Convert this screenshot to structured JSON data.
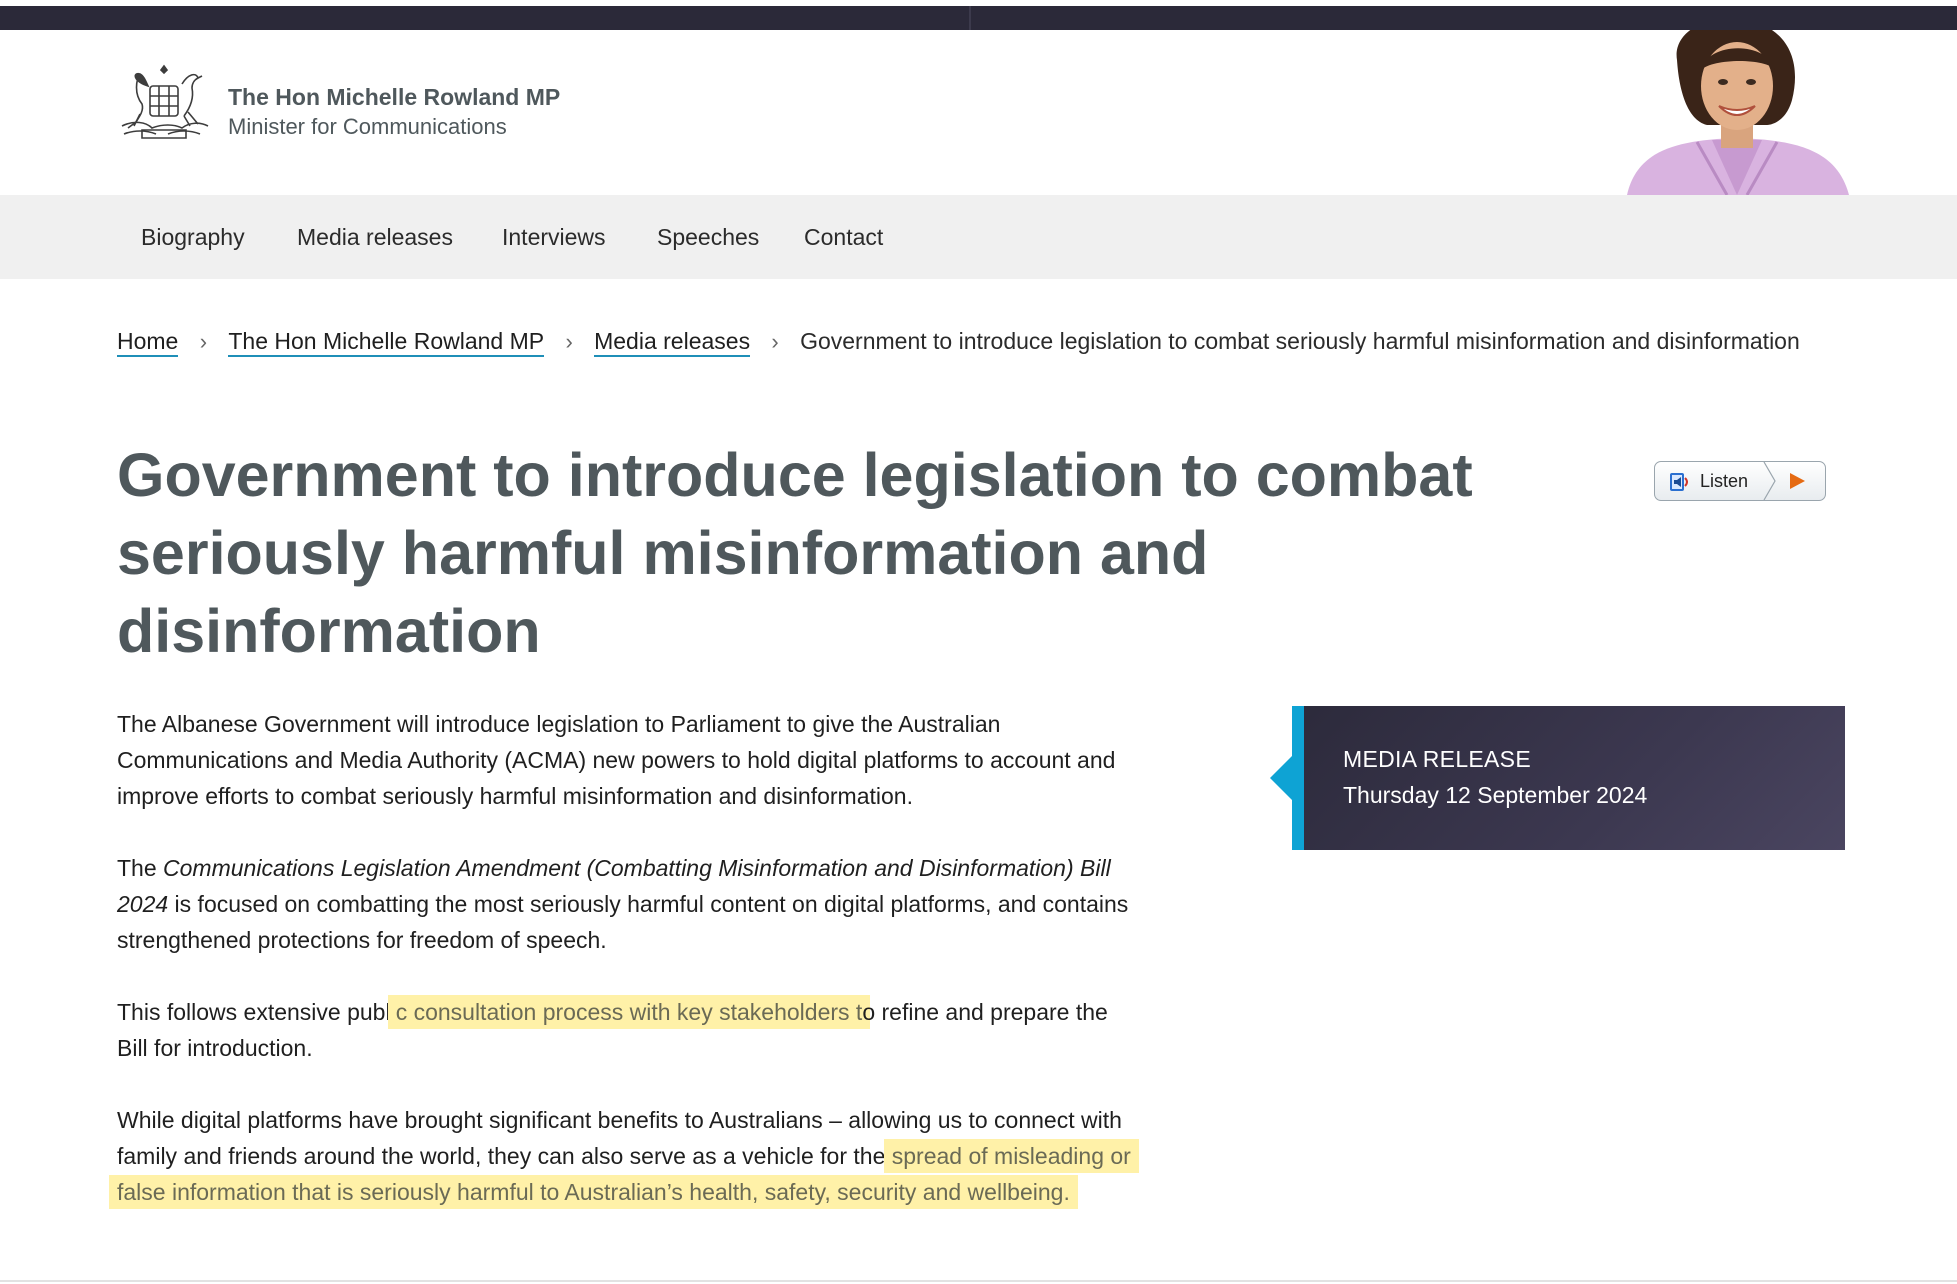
{
  "header": {
    "minister_name": "The Hon Michelle Rowland MP",
    "minister_role": "Minister for Communications"
  },
  "nav": {
    "items": [
      "Biography",
      "Media releases",
      "Interviews",
      "Speeches",
      "Contact"
    ]
  },
  "breadcrumb": {
    "items": [
      "Home",
      "The Hon Michelle Rowland MP",
      "Media releases"
    ],
    "current": "Government to introduce legislation to combat seriously harmful misinformation and disinformation"
  },
  "article": {
    "title": "Government to introduce legislation to combat seriously harmful misinformation and disinformation",
    "p1": "The Albanese Government will introduce legislation to Parliament to give the Australian Communications and Media Authority (ACMA) new powers to hold digital platforms to account and improve efforts to combat seriously harmful misinformation and disinformation.",
    "p2_prefix": "The ",
    "p2_italic": "Communications Legislation Amendment (Combatting Misinformation and Disinformation) Bill 2024",
    "p2_suffix": " is focused on combatting the most seriously harmful content on digital platforms, and contains strengthened protections for freedom of speech.",
    "p3_prefix": "This follows extensive publi",
    "p3_highlight": "c consultation process with key stakeholders t",
    "p3_suffix": "o refine and prepare the Bill for introduction.",
    "p4_prefix": "While digital platforms have brought significant benefits to Australians – allowing us to connect with family and friends around the world, they can also serve as a vehicle for the ",
    "p4_highlight": "spread of misleading or false information that is seriously harmful to Australian’s health, safety, security and wellbeing."
  },
  "listen": {
    "label": "Listen"
  },
  "release_box": {
    "kind": "MEDIA RELEASE",
    "date": "Thursday 12 September 2024"
  },
  "colors": {
    "heading": "#4f585c",
    "accent_blue": "#0ea3d4",
    "release_box_bg": "#2c2a3b",
    "highlight": "#fff1a8",
    "nav_bg": "#f0f0f0"
  }
}
